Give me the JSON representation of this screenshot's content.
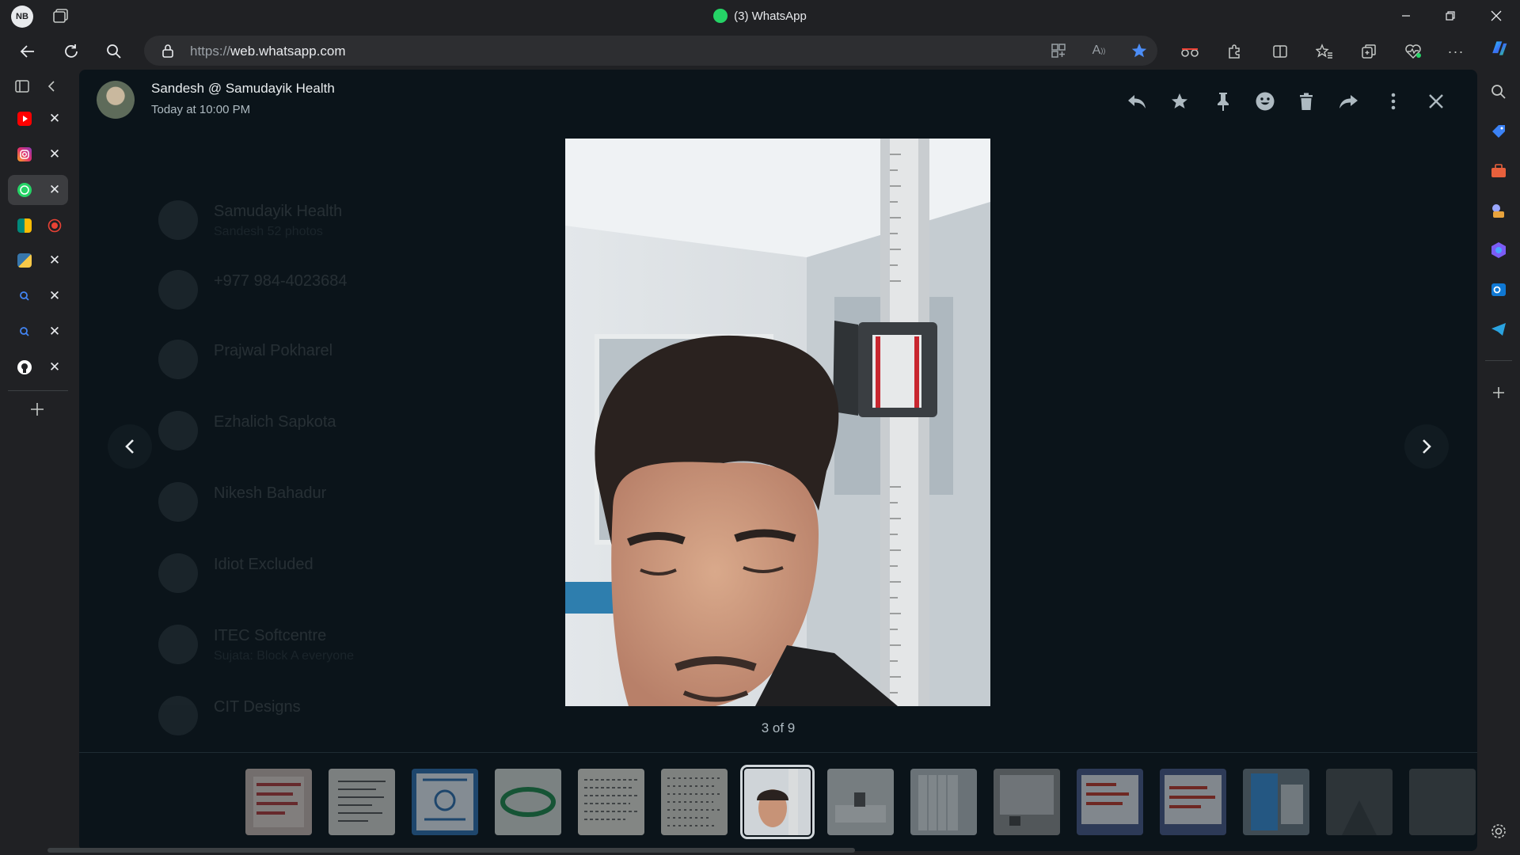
{
  "browser": {
    "profile_initials": "NB",
    "window_title": "(3) WhatsApp",
    "url_protocol": "https://",
    "url_host": "web.whatsapp.com",
    "accent": "#4c8df6"
  },
  "vertical_tabs": [
    {
      "name": "youtube",
      "color": "#ff0000"
    },
    {
      "name": "instagram",
      "color": "#e1306c"
    },
    {
      "name": "whatsapp",
      "color": "#25d366",
      "active": true
    },
    {
      "name": "google-meet",
      "color": "#00897b",
      "recording": true
    },
    {
      "name": "python",
      "color": "#f7c948"
    },
    {
      "name": "search",
      "color": "#4285f4"
    },
    {
      "name": "search",
      "color": "#4285f4"
    },
    {
      "name": "github",
      "color": "#ffffff"
    }
  ],
  "viewer": {
    "sender_name": "Sandesh @ Samudayik Health",
    "timestamp": "Today at 10:00 PM",
    "counter": "3 of 9",
    "actions": [
      "reply-icon",
      "star-icon",
      "pin-icon",
      "emoji-icon",
      "delete-icon",
      "forward-icon",
      "more-icon",
      "close-icon"
    ]
  },
  "background_chats": [
    {
      "name": "Samudayik Health",
      "preview": "Sandesh 52 photos"
    },
    {
      "name": "+977 984-4023684",
      "preview": ""
    },
    {
      "name": "Prajwal Pokharel",
      "preview": ""
    },
    {
      "name": "Ezhalich Sapkota",
      "preview": ""
    },
    {
      "name": "Nikesh Bahadur",
      "preview": ""
    },
    {
      "name": "Idiot Excluded",
      "preview": ""
    },
    {
      "name": "ITEC Softcentre",
      "preview": "Sujata: Block A everyone"
    },
    {
      "name": "CIT Designs",
      "preview": ""
    }
  ],
  "thumbnails": [
    {
      "kind": "poster",
      "color": "#c8b9b2"
    },
    {
      "kind": "document",
      "color": "#d7d7d2"
    },
    {
      "kind": "certificate",
      "color": "#2f6fb0"
    },
    {
      "kind": "logo",
      "color": "#1f8a4c"
    },
    {
      "kind": "handwritten",
      "color": "#e6e4dc"
    },
    {
      "kind": "handwritten",
      "color": "#dcdad2"
    },
    {
      "kind": "selfie",
      "color": "#9aa4ab",
      "selected": true
    },
    {
      "kind": "room",
      "color": "#cfd3d5"
    },
    {
      "kind": "room",
      "color": "#b8c0c4"
    },
    {
      "kind": "room",
      "color": "#8d8e90"
    },
    {
      "kind": "screen",
      "color": "#d9dde8"
    },
    {
      "kind": "screen",
      "color": "#d9dde8"
    },
    {
      "kind": "screen",
      "color": "#3a8ed8"
    },
    {
      "kind": "dark",
      "color": "#4a4f52"
    },
    {
      "kind": "dark",
      "color": "#4a4f52"
    }
  ]
}
